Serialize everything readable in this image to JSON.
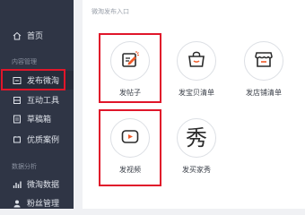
{
  "sidebar": {
    "home": "首页",
    "content_section": "内容管理",
    "items": [
      {
        "label": "发布微淘",
        "icon": "send-icon"
      },
      {
        "label": "互动工具",
        "icon": "tools-icon"
      },
      {
        "label": "草稿箱",
        "icon": "draft-icon"
      },
      {
        "label": "优质案例",
        "icon": "case-icon"
      }
    ],
    "data_section": "数据分析",
    "data_items": [
      {
        "label": "微淘数据",
        "icon": "chart-icon"
      },
      {
        "label": "粉丝管理",
        "icon": "fans-icon"
      }
    ]
  },
  "main": {
    "title": "微淘发布入口",
    "tiles": [
      {
        "label": "发帖子",
        "icon": "edit-post-icon"
      },
      {
        "label": "发宝贝清单",
        "icon": "shopping-bag-icon"
      },
      {
        "label": "发店铺清单",
        "icon": "shop-icon"
      },
      {
        "label": "发视频",
        "icon": "video-play-icon"
      },
      {
        "label": "发买家秀",
        "icon": "xiu-icon",
        "glyph": "秀"
      }
    ]
  },
  "colors": {
    "sidebar_bg": "#2f3545",
    "highlight": "#e0162a",
    "accent": "#f05a28"
  }
}
